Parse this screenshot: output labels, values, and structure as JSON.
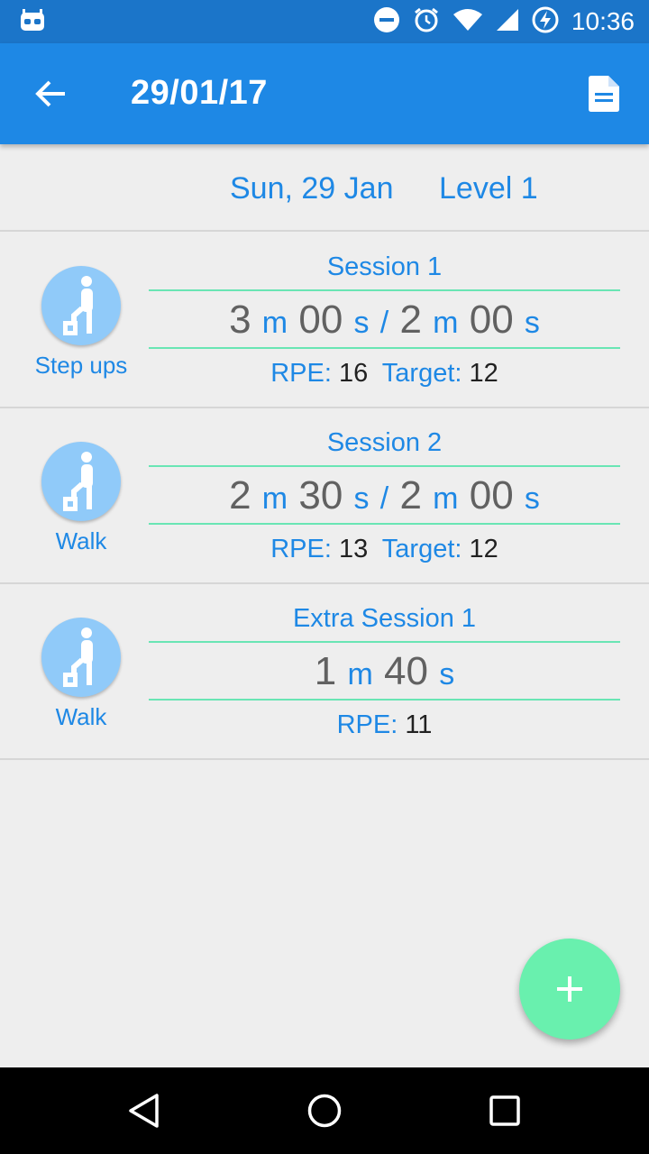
{
  "status_bar": {
    "time": "10:36",
    "icons": [
      "android-debug-icon",
      "do-not-disturb-icon",
      "alarm-icon",
      "wifi-icon",
      "signal-icon",
      "battery-charging-icon"
    ]
  },
  "app_bar": {
    "title": "29/01/17",
    "back_icon": "arrow-back-icon",
    "action_icon": "document-icon"
  },
  "day": {
    "date": "Sun, 29 Jan",
    "level": "Level 1"
  },
  "sessions": [
    {
      "activity": "Step ups",
      "title": "Session 1",
      "time": {
        "m1": "3",
        "s1": "00",
        "m2": "2",
        "s2": "00",
        "unit_m": "m",
        "unit_s": "s",
        "sep": "/"
      },
      "rpe_label": "RPE:",
      "rpe": "16",
      "target_label": "Target:",
      "target": "12"
    },
    {
      "activity": "Walk",
      "title": "Session 2",
      "time": {
        "m1": "2",
        "s1": "30",
        "m2": "2",
        "s2": "00",
        "unit_m": "m",
        "unit_s": "s",
        "sep": "/"
      },
      "rpe_label": "RPE:",
      "rpe": "13",
      "target_label": "Target:",
      "target": "12"
    },
    {
      "activity": "Walk",
      "title": "Extra Session 1",
      "time": {
        "m1": "1",
        "s1": "40",
        "unit_m": "m",
        "unit_s": "s"
      },
      "rpe_label": "RPE:",
      "rpe": "11"
    }
  ],
  "fab": {
    "icon": "plus-icon"
  },
  "nav": {
    "icons": [
      "back-triangle-icon",
      "home-circle-icon",
      "recents-square-icon"
    ]
  },
  "colors": {
    "status_bar": "#1b75c9",
    "app_bar": "#1e88e5",
    "accent_text": "#1e88e5",
    "divider_green": "#69e5b4",
    "fab": "#69f0ae",
    "avatar": "#90caf9",
    "background": "#eeeeee"
  }
}
